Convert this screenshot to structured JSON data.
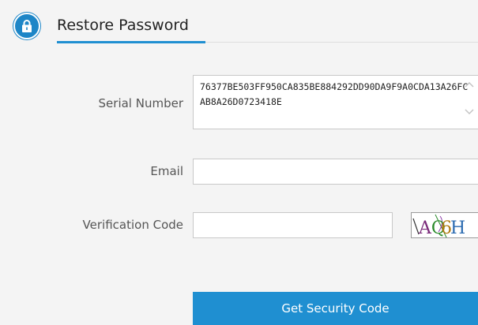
{
  "header": {
    "title": "Restore Password",
    "icon": "lock-icon",
    "accent_color": "#1f8fd1"
  },
  "form": {
    "serial_number": {
      "label": "Serial Number",
      "value": "76377BE503FF950CA835BE884292DD90DA9F9A0CDA13A26FCAB8A26D0723418E"
    },
    "email": {
      "label": "Email",
      "value": ""
    },
    "verification_code": {
      "label": "Verification Code",
      "value": "",
      "captcha_text": "AQ6H"
    }
  },
  "actions": {
    "get_security_code_label": "Get Security Code"
  }
}
